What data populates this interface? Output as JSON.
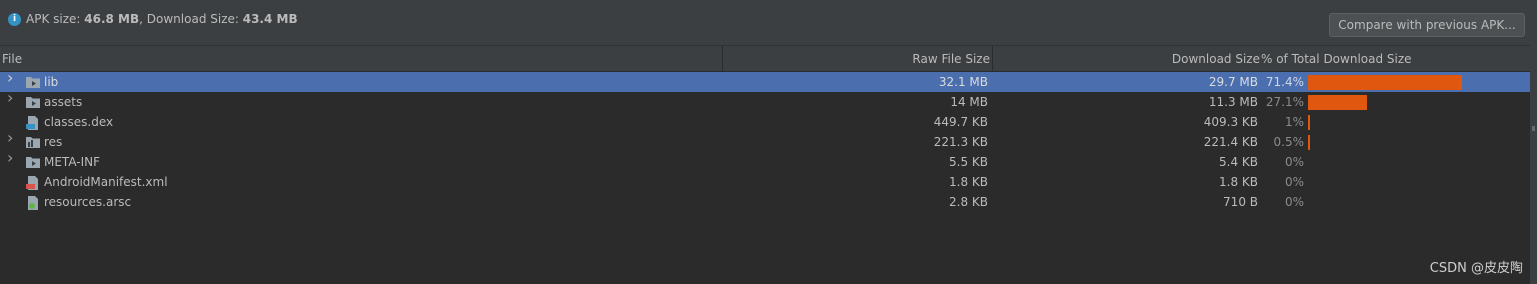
{
  "summary": {
    "apk_label": "APK size: ",
    "apk_value": "46.8 MB",
    "sep": ", ",
    "download_label": "Download Size: ",
    "download_value": "43.4 MB"
  },
  "compare_button": "Compare with previous APK...",
  "columns": {
    "file": "File",
    "raw": "Raw File Size",
    "download": "Download Size",
    "percent": "% of Total Download Size"
  },
  "rows": [
    {
      "name": "lib",
      "raw": "32.1 MB",
      "download": "29.7 MB",
      "percent": "71.4%",
      "fraction": 0.714,
      "expandable": true,
      "icon": "folder-icon",
      "selected": true
    },
    {
      "name": "assets",
      "raw": "14 MB",
      "download": "11.3 MB",
      "percent": "27.1%",
      "fraction": 0.271,
      "expandable": true,
      "icon": "folder-icon",
      "selected": false
    },
    {
      "name": "classes.dex",
      "raw": "449.7 KB",
      "download": "409.3 KB",
      "percent": "1%",
      "fraction": 0.01,
      "expandable": false,
      "icon": "dex-file-icon",
      "selected": false
    },
    {
      "name": "res",
      "raw": "221.3 KB",
      "download": "221.4 KB",
      "percent": "0.5%",
      "fraction": 0.005,
      "expandable": true,
      "icon": "resource-folder-icon",
      "selected": false
    },
    {
      "name": "META-INF",
      "raw": "5.5 KB",
      "download": "5.4 KB",
      "percent": "0%",
      "fraction": 0,
      "expandable": true,
      "icon": "folder-icon",
      "selected": false
    },
    {
      "name": "AndroidManifest.xml",
      "raw": "1.8 KB",
      "download": "1.8 KB",
      "percent": "0%",
      "fraction": 0,
      "expandable": false,
      "icon": "xml-file-icon",
      "selected": false
    },
    {
      "name": "resources.arsc",
      "raw": "2.8 KB",
      "download": "710 B",
      "percent": "0%",
      "fraction": 0,
      "expandable": false,
      "icon": "arsc-file-icon",
      "selected": false
    }
  ],
  "colors": {
    "bar": "#e0580f",
    "selection": "#4b6eaf",
    "background": "#2b2b2b"
  },
  "watermark": "CSDN @皮皮陶"
}
